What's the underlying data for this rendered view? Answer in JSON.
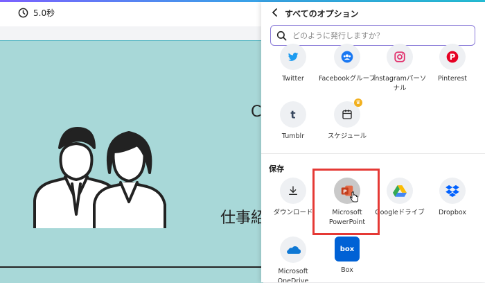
{
  "timer": {
    "label": "5.0秒",
    "icon": "clock-icon"
  },
  "canvas": {
    "title_fragment": "仕事紹",
    "side_char": "C"
  },
  "panel": {
    "title": "すべてのオプション",
    "search_placeholder": "どのように発行しますか？",
    "share_options": [
      {
        "label": "Twitter",
        "icon": "twitter-icon"
      },
      {
        "label": "Facebookグループ",
        "icon": "facebook-group-icon"
      },
      {
        "label": "Instagramパーソナル",
        "icon": "instagram-icon"
      },
      {
        "label": "Pinterest",
        "icon": "pinterest-icon"
      },
      {
        "label": "Tumblr",
        "icon": "tumblr-icon"
      },
      {
        "label": "スケジュール",
        "icon": "calendar-icon"
      }
    ],
    "save_section": "保存",
    "save_options": [
      {
        "label": "ダウンロード",
        "icon": "download-icon"
      },
      {
        "label": "Microsoft PowerPoint",
        "icon": "powerpoint-icon"
      },
      {
        "label": "Googleドライブ",
        "icon": "google-drive-icon"
      },
      {
        "label": "Dropbox",
        "icon": "dropbox-icon"
      },
      {
        "label": "Microsoft OneDrive",
        "icon": "onedrive-icon"
      },
      {
        "label": "Box",
        "icon": "box-icon"
      }
    ]
  },
  "colors": {
    "accent": "#8a7bd8",
    "highlight": "#e53935",
    "canvas_bg": "#a8d8d8"
  }
}
